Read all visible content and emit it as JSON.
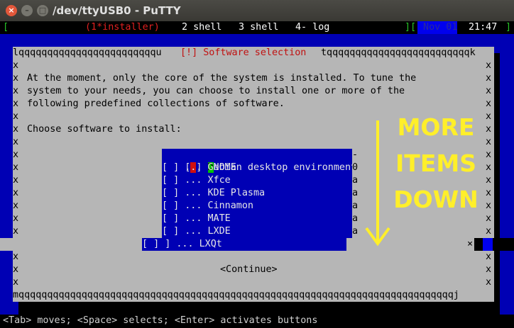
{
  "window": {
    "title": "/dev/ttyUSB0 - PuTTY",
    "close_label": "×",
    "min_label": "–",
    "max_label": "□"
  },
  "screen_status": {
    "left_bracket": "[",
    "window_active_num": "(1*installer)",
    "window_2": "2 shell",
    "window_3": "3 shell",
    "window_4": "4- log",
    "right_brackets": "][",
    "date": " Nov 01",
    "time": "21:47",
    "end_bracket": "]"
  },
  "dialog": {
    "title": "[!] Software selection",
    "frame_top_left": "lqqqqqqqqqqqqqqqqqqqqqqqqu",
    "frame_top_right": "tqqqqqqqqqqqqqqqqqqqqqqqqqk",
    "frame_bottom": "mqqqqqqqqqqqqqqqqqqqqqqqqqqqqqqqqqqqqqqqqqqqqqqqqqqqqqqqqqqqqqqqqqqqqqqqqqqqqj",
    "side_char": "x",
    "intro_lines": [
      "At the moment, only the core of the system is installed. To tune the",
      "system to your needs, you can choose to install one or more of the",
      "following predefined collections of software."
    ],
    "prompt": "Choose software to install:",
    "items": [
      {
        "check": "[",
        "check_mark": " ",
        "check_end": "]",
        "label_first": "D",
        "label_rest": "ebian desktop environment",
        "right_char": "-"
      },
      {
        "check": "[ ]",
        "label": " ... GNOME",
        "right_char": "0"
      },
      {
        "check": "[ ]",
        "label": " ... Xfce",
        "right_char": "a"
      },
      {
        "check": "[ ]",
        "label": " ... KDE Plasma",
        "right_char": "a"
      },
      {
        "check": "[ ]",
        "label": " ... Cinnamon",
        "right_char": "a"
      },
      {
        "check": "[ ]",
        "label": " ... MATE",
        "right_char": "a"
      },
      {
        "check": "[ ]",
        "label": " ... LXDE",
        "right_char": "a"
      }
    ],
    "last_item": {
      "check_outer": "[ ]",
      "check": "]",
      "label": " ... LXQt"
    },
    "stray_x": "×",
    "continue_label": "<Continue>"
  },
  "help_bar": "<Tab> moves; <Space> selects; <Enter> activates buttons",
  "annotation": {
    "lines": [
      "MORE",
      "ITEMS",
      "DOWN"
    ],
    "arrow_color": "#ffef2a"
  }
}
